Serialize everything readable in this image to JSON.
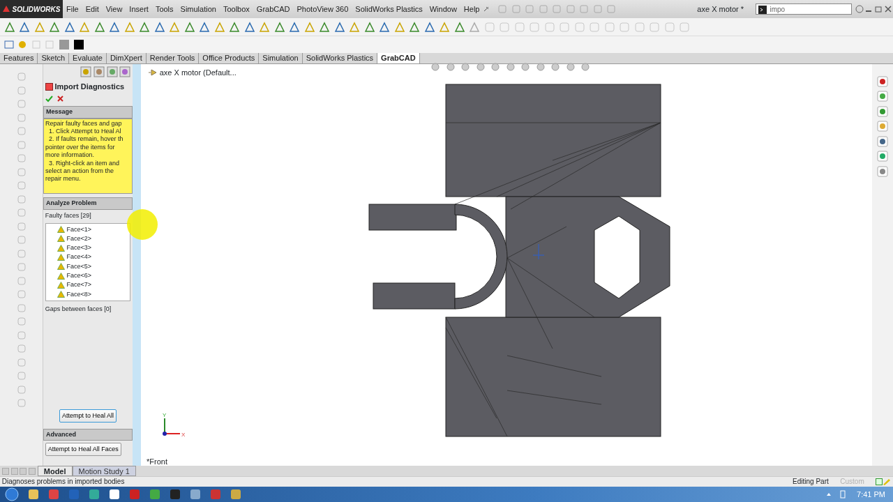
{
  "title_bar": {
    "logo": "SOLIDWORKS",
    "menus": [
      "File",
      "Edit",
      "View",
      "Insert",
      "Tools",
      "Simulation",
      "Toolbox",
      "GrabCAD",
      "PhotoView 360",
      "SolidWorks Plastics",
      "Window",
      "Help"
    ],
    "document_title": "axe X motor *",
    "search": {
      "value": "impo"
    }
  },
  "command_tabs": [
    {
      "label": "Features",
      "selected": false
    },
    {
      "label": "Sketch",
      "selected": false
    },
    {
      "label": "Evaluate",
      "selected": false
    },
    {
      "label": "DimXpert",
      "selected": false
    },
    {
      "label": "Render Tools",
      "selected": false
    },
    {
      "label": "Office Products",
      "selected": false
    },
    {
      "label": "Simulation",
      "selected": false
    },
    {
      "label": "SolidWorks Plastics",
      "selected": false
    },
    {
      "label": "GrabCAD",
      "selected": true
    }
  ],
  "feature_tree": {
    "root": "axe X motor  (Default..."
  },
  "panel": {
    "title": "Import Diagnostics",
    "message": {
      "header": "Message",
      "lines": [
        "Repair faulty faces and gap",
        "  1. Click Attempt to Heal Al",
        "  2. If faults remain, hover th",
        "pointer over the items for",
        "more information.",
        "  3. Right-click an item and",
        "select an action from the",
        "repair menu."
      ]
    },
    "analyze": {
      "header": "Analyze Problem",
      "faulty_label": "Faulty faces [29]",
      "faces": [
        "Face<1>",
        "Face<2>",
        "Face<3>",
        "Face<4>",
        "Face<5>",
        "Face<6>",
        "Face<7>",
        "Face<8>"
      ],
      "gaps_label": "Gaps between faces [0]",
      "heal_button": "Attempt to Heal All"
    },
    "advanced": {
      "header": "Advanced",
      "button": "Attempt to Heal All Faces"
    }
  },
  "viewport": {
    "view_name": "*Front",
    "axis_y": "Y",
    "axis_x": "X"
  },
  "bottom_tabs": [
    {
      "label": "Model",
      "selected": true
    },
    {
      "label": "Motion Study 1",
      "selected": false
    }
  ],
  "status_bar": {
    "message": "Diagnoses problems in imported bodies",
    "mode": "Editing Part",
    "units": {
      "label": "Custom",
      "disabled": true
    }
  },
  "taskbar": {
    "clock": "7:41 PM"
  }
}
